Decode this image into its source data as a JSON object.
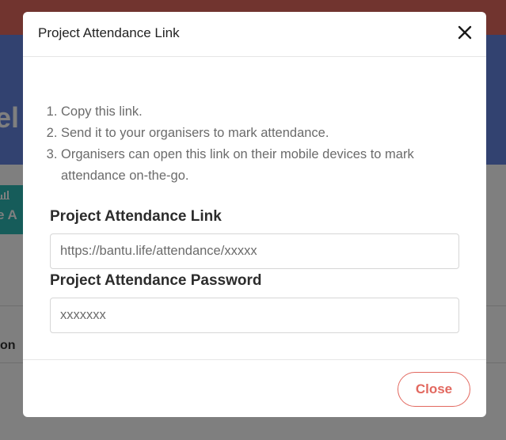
{
  "background": {
    "hero_title_fragment": "el",
    "button_icon": "bar-chart-icon",
    "button_label_fragment": "e A",
    "column_label_fragment": "on"
  },
  "modal": {
    "title": "Project Attendance Link",
    "instructions": [
      "Copy this link.",
      "Send it to your organisers to mark attendance.",
      "Organisers can open this link on their mobile devices to mark attendance on-the-go."
    ],
    "link_field": {
      "label": "Project Attendance Link",
      "value": "https://bantu.life/attendance/xxxxx"
    },
    "password_field": {
      "label": "Project Attendance Password",
      "value": "xxxxxxx"
    },
    "close_button_label": "Close"
  },
  "colors": {
    "accent": "#e2685f",
    "hero": "#6585e0",
    "teal": "#2cb8b4"
  }
}
